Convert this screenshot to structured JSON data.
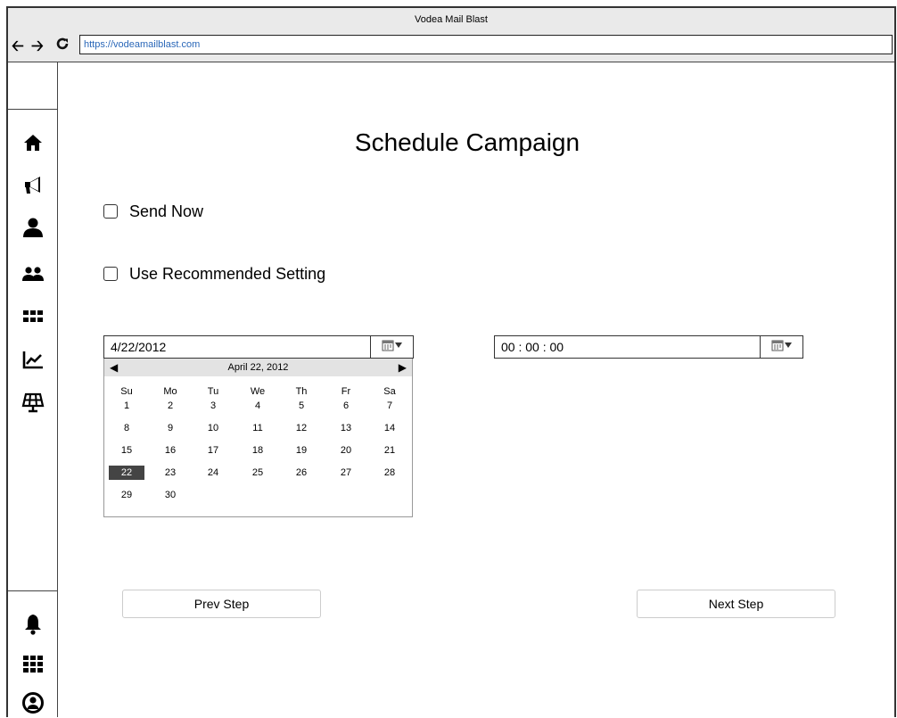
{
  "window": {
    "title": "Vodea Mail Blast"
  },
  "browser": {
    "back": "back",
    "forward": "forward",
    "reload": "reload",
    "url": "https://vodeamailblast.com"
  },
  "sidebar": {
    "top_icons": [
      "home-icon",
      "megaphone-icon",
      "user-icon",
      "users-icon",
      "apps-icon",
      "chart-line-icon",
      "solar-panel-icon"
    ],
    "bottom_icons": [
      "bell-icon",
      "grid-icon",
      "user-circle-icon"
    ]
  },
  "page": {
    "title": "Schedule Campaign",
    "send_now_label": "Send Now",
    "send_now_checked": false,
    "recommended_label": "Use Recommended Setting",
    "recommended_checked": false
  },
  "date_picker": {
    "value": "4/22/2012",
    "calendar_header": "April 22, 2012",
    "weekdays": [
      "Su",
      "Mo",
      "Tu",
      "We",
      "Th",
      "Fr",
      "Sa"
    ],
    "weeks": [
      [
        "1",
        "2",
        "3",
        "4",
        "5",
        "6",
        "7"
      ],
      [
        "8",
        "9",
        "10",
        "11",
        "12",
        "13",
        "14"
      ],
      [
        "15",
        "16",
        "17",
        "18",
        "19",
        "20",
        "21"
      ],
      [
        "22",
        "23",
        "24",
        "25",
        "26",
        "27",
        "28"
      ],
      [
        "29",
        "30",
        "",
        "",
        "",
        "",
        ""
      ]
    ],
    "selected_day": "22"
  },
  "time_picker": {
    "value": "00 : 00 : 00"
  },
  "buttons": {
    "prev": "Prev Step",
    "next": "Next Step"
  },
  "colors": {
    "link": "#2a67b8",
    "selected_day_bg": "#444444",
    "chrome_bg": "#eaeaea"
  }
}
